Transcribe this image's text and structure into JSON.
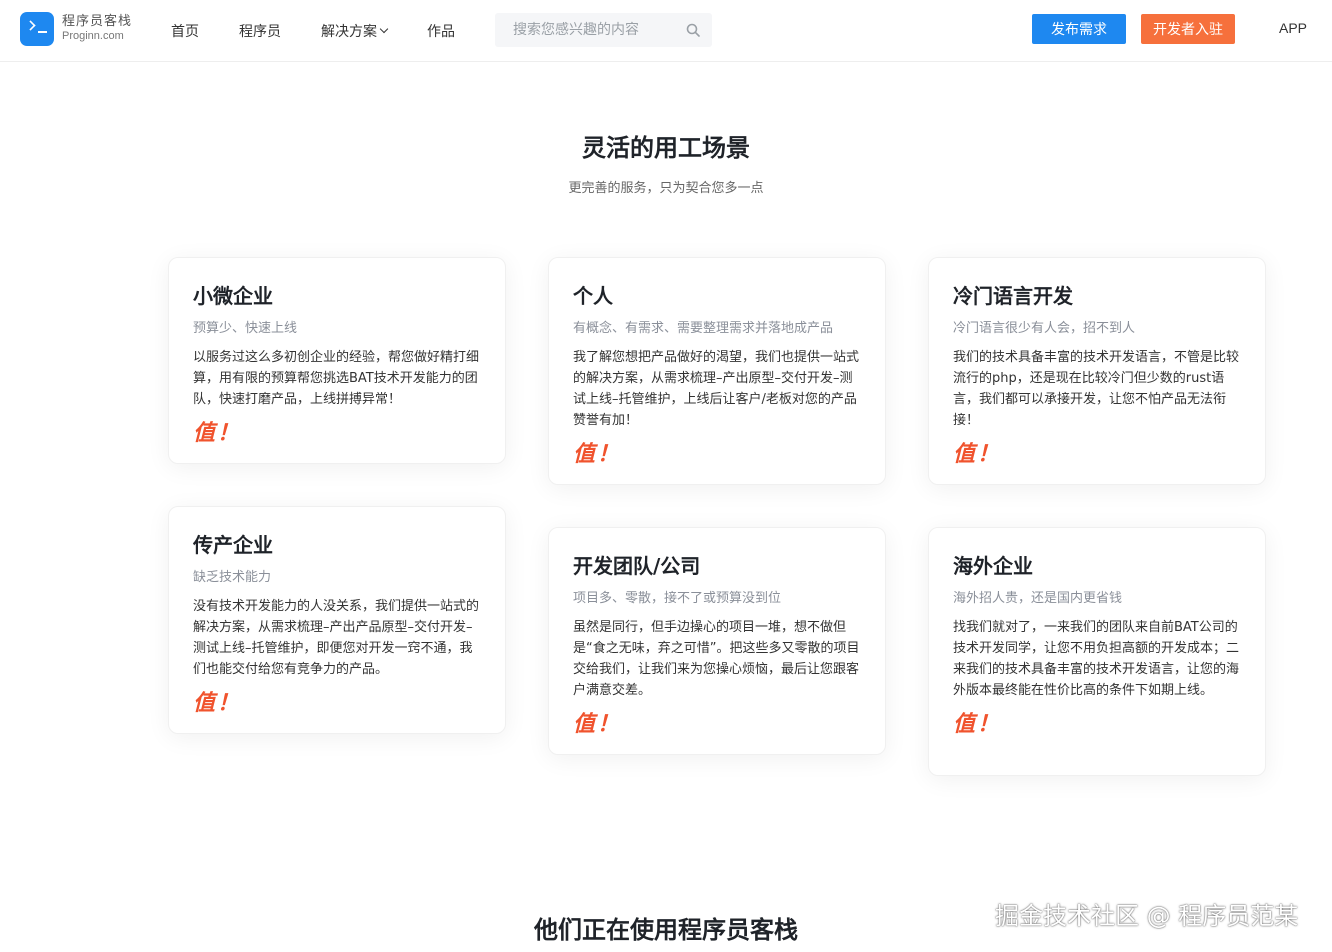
{
  "header": {
    "logo_cn": "程序员客栈",
    "logo_en": "Proginn.com",
    "nav": [
      {
        "label": "首页"
      },
      {
        "label": "程序员"
      },
      {
        "label": "解决方案"
      },
      {
        "label": "作品"
      }
    ],
    "search_placeholder": "搜索您感兴趣的内容",
    "publish_label": "发布需求",
    "developer_label": "开发者入驻",
    "app_label": "APP"
  },
  "section": {
    "title": "灵活的用工场景",
    "subtitle": "更完善的服务，只为契合您多一点"
  },
  "cards": [
    {
      "title": "小微企业",
      "subtitle": "预算少、快速上线",
      "body": "以服务过这么多初创企业的经验，帮您做好精打细算，用有限的预算帮您挑选BAT技术开发能力的团队，快速打磨产品，上线拼搏异常！",
      "badge": "值！"
    },
    {
      "title": "个人",
      "subtitle": "有概念、有需求、需要整理需求并落地成产品",
      "body": "我了解您想把产品做好的渴望，我们也提供一站式的解决方案，从需求梳理–产出原型–交付开发–测试上线–托管维护，上线后让客户/老板对您的产品赞誉有加！",
      "badge": "值！"
    },
    {
      "title": "冷门语言开发",
      "subtitle": "冷门语言很少有人会，招不到人",
      "body": "我们的技术具备丰富的技术开发语言，不管是比较流行的php，还是现在比较冷门但少数的rust语言，我们都可以承接开发，让您不怕产品无法衔接！",
      "badge": "值！"
    },
    {
      "title": "传产企业",
      "subtitle": "缺乏技术能力",
      "body": "没有技术开发能力的人没关系，我们提供一站式的解决方案，从需求梳理–产出产品原型–交付开发–测试上线–托管维护，即便您对开发一窍不通，我们也能交付给您有竞争力的产品。",
      "badge": "值！"
    },
    {
      "title": "开发团队/公司",
      "subtitle": "项目多、零散，接不了或预算没到位",
      "body": "虽然是同行，但手边操心的项目一堆，想不做但是“食之无味，弃之可惜”。把这些多又零散的项目交给我们，让我们来为您操心烦恼，最后让您跟客户满意交差。",
      "badge": "值！"
    },
    {
      "title": "海外企业",
      "subtitle": "海外招人贵，还是国内更省钱",
      "body": "找我们就对了，一来我们的团队来自前BAT公司的技术开发同学，让您不用负担高额的开发成本；二来我们的技术具备丰富的技术开发语言，让您的海外版本最终能在性价比高的条件下如期上线。",
      "badge": "值！"
    }
  ],
  "bottom_title": "他们正在使用程序员客栈",
  "watermark": "掘金技术社区 @ 程序员范某",
  "colors": {
    "primary": "#1e88f0",
    "accent": "#f6703c",
    "badge": "#f0532d"
  }
}
